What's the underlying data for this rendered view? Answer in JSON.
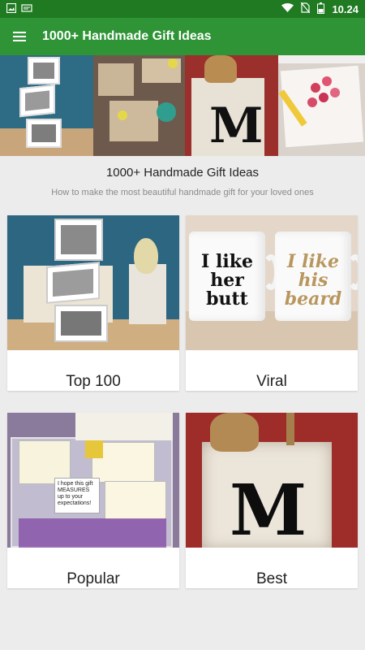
{
  "status_bar": {
    "time": "10.24",
    "carrier_icon": "notification-icon"
  },
  "app_bar": {
    "title": "1000+ Handmade Gift Ideas",
    "menu_icon": "hamburger-menu-icon"
  },
  "header": {
    "title": "1000+ Handmade Gift Ideas",
    "subtitle": "How to make the most beautiful handmade gift for your loved ones"
  },
  "banner": {
    "letter": "M"
  },
  "cards": [
    {
      "label": "Top 100"
    },
    {
      "label": "Viral",
      "mug_left_text": "I like her butt",
      "mug_right_text": "I like his beard"
    },
    {
      "label": "Popular",
      "note_text": "I hope this gift MEASURES up to your expectations!"
    },
    {
      "label": "Best",
      "letter": "M"
    }
  ],
  "colors": {
    "status_bar": "#1f7a22",
    "app_bar": "#2e9436",
    "background": "#ececec"
  }
}
